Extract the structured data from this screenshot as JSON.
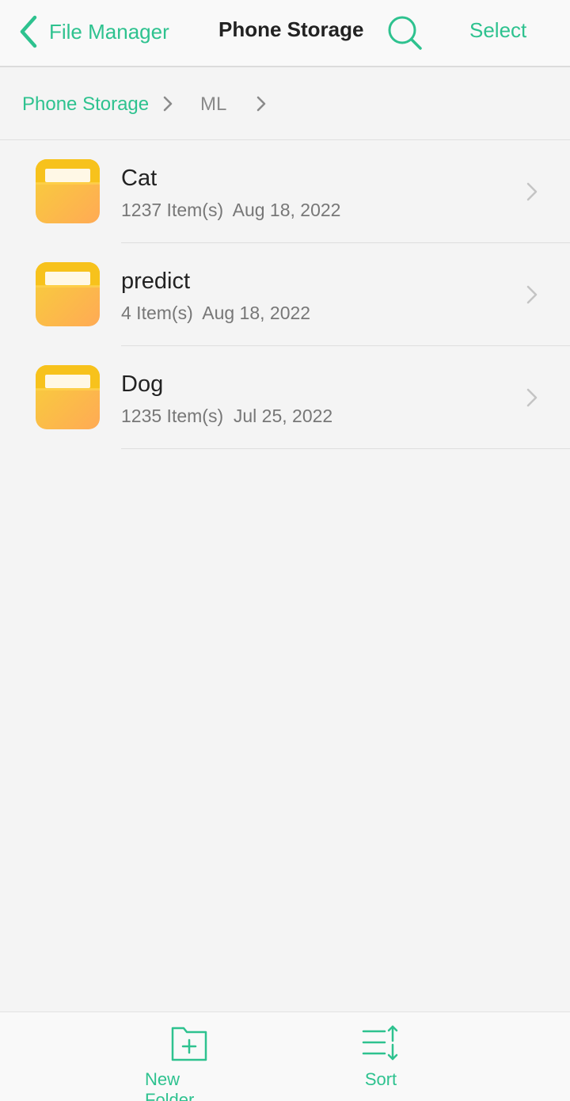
{
  "header": {
    "back_label": "File Manager",
    "title": "Phone Storage",
    "select_label": "Select",
    "search_icon": "search-icon"
  },
  "breadcrumb": {
    "items": [
      "Phone Storage",
      "ML"
    ]
  },
  "files": [
    {
      "name": "Cat",
      "meta": "1237 Item(s)  Aug 18, 2022",
      "icon": "folder-icon"
    },
    {
      "name": "predict",
      "meta": "4 Item(s)  Aug 18, 2022",
      "icon": "folder-icon"
    },
    {
      "name": "Dog",
      "meta": "1235 Item(s)  Jul 25, 2022",
      "icon": "folder-icon"
    }
  ],
  "toolbar": {
    "new_folder_label": "New Folder",
    "sort_label": "Sort"
  },
  "colors": {
    "accent": "#2ec28f",
    "folder_top": "#f7c52a",
    "folder_bottom": "#ffb454",
    "background": "#f4f4f4"
  }
}
